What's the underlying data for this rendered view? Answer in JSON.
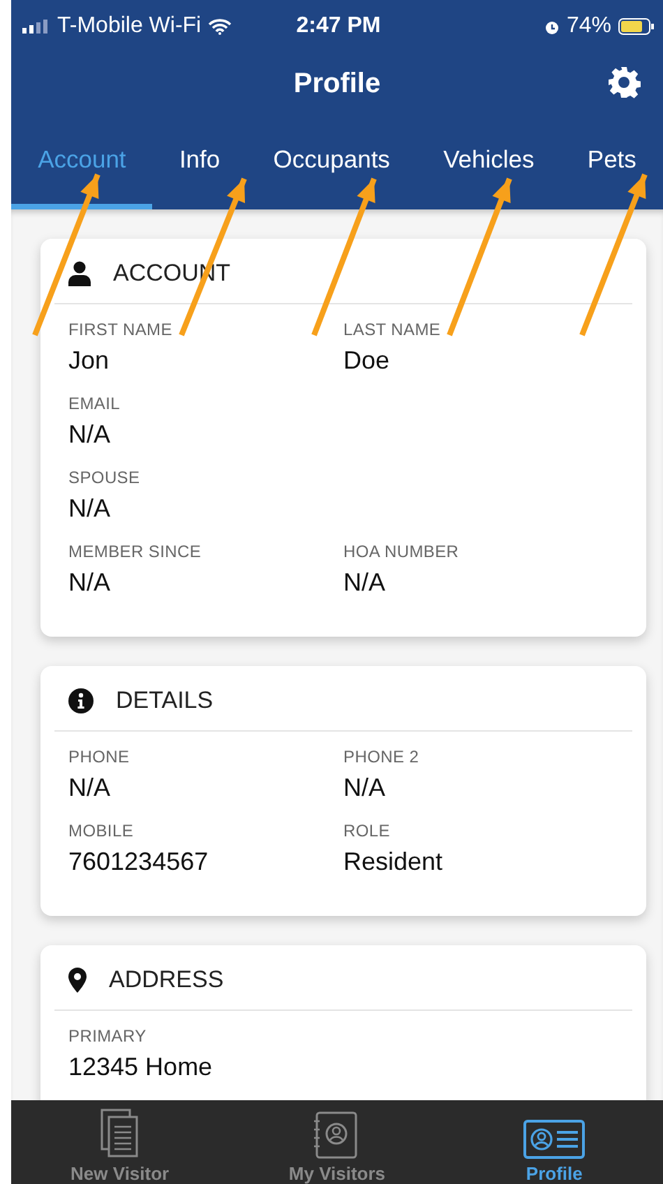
{
  "status_bar": {
    "carrier": "T-Mobile Wi-Fi",
    "time": "2:47 PM",
    "battery": "74%"
  },
  "header": {
    "title": "Profile"
  },
  "tabs": [
    {
      "label": "Account",
      "selected": true
    },
    {
      "label": "Info",
      "selected": false
    },
    {
      "label": "Occupants",
      "selected": false
    },
    {
      "label": "Vehicles",
      "selected": false
    },
    {
      "label": "Pets",
      "selected": false
    }
  ],
  "cards": [
    {
      "kind": "person",
      "title": "ACCOUNT",
      "fields": [
        {
          "label": "FIRST NAME",
          "value": "Jon",
          "kind": "half"
        },
        {
          "label": "LAST NAME",
          "value": "Doe",
          "kind": "half"
        },
        {
          "label": "EMAIL",
          "value": "N/A",
          "kind": "full"
        },
        {
          "label": "SPOUSE",
          "value": "N/A",
          "kind": "full"
        },
        {
          "label": "MEMBER SINCE",
          "value": "N/A",
          "kind": "half"
        },
        {
          "label": "HOA NUMBER",
          "value": "N/A",
          "kind": "half"
        }
      ]
    },
    {
      "kind": "info",
      "title": "DETAILS",
      "fields": [
        {
          "label": "PHONE",
          "value": "N/A",
          "kind": "half"
        },
        {
          "label": "PHONE 2",
          "value": "N/A",
          "kind": "half"
        },
        {
          "label": "MOBILE",
          "value": "7601234567",
          "kind": "half"
        },
        {
          "label": "ROLE",
          "value": "Resident",
          "kind": "half"
        }
      ]
    },
    {
      "kind": "pin",
      "title": "ADDRESS",
      "fields": [
        {
          "label": "PRIMARY",
          "value": "12345 Home",
          "kind": "full"
        }
      ]
    }
  ],
  "bottom_nav": [
    {
      "kind": "pages",
      "label": "New Visitor",
      "selected": false
    },
    {
      "kind": "book",
      "label": "My Visitors",
      "selected": false
    },
    {
      "kind": "card",
      "label": "Profile",
      "selected": true
    }
  ],
  "annotations": [
    {
      "kind": "arrow"
    },
    {
      "kind": "arrow"
    },
    {
      "kind": "arrow"
    },
    {
      "kind": "arrow"
    },
    {
      "kind": "arrow"
    }
  ]
}
